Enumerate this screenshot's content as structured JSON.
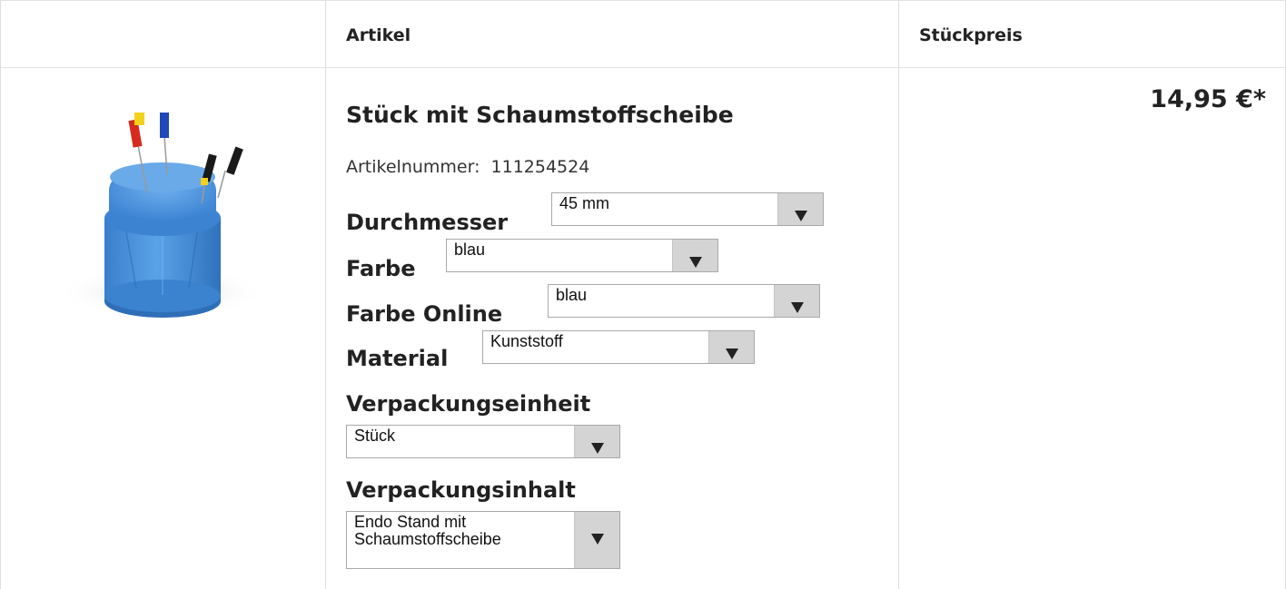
{
  "table": {
    "header": {
      "col_article": "Artikel",
      "col_price": "Stückpreis"
    }
  },
  "product": {
    "image_alt": "Endo Stand",
    "title": "Stück mit Schaumstoffscheibe",
    "article_number_label": "Artikelnummer:",
    "article_number": "111254524",
    "price": "14,95 €*",
    "options": [
      {
        "label": "Durchmesser",
        "selected": "45 mm"
      },
      {
        "label": "Farbe",
        "selected": "blau"
      },
      {
        "label": "Farbe Online",
        "selected": "blau"
      },
      {
        "label": "Material",
        "selected": "Kunststoff"
      },
      {
        "label": "Verpackungseinheit",
        "selected": "Stück"
      },
      {
        "label": "Verpackungsinhalt",
        "selected": "Endo Stand mit Schaumstoffscheibe"
      }
    ]
  },
  "colors": {
    "border": "#dddddd",
    "select_button": "#d4d4d4",
    "product_blue": "#4a93de"
  },
  "icons": {
    "select_arrow": "triangle-down-icon"
  }
}
